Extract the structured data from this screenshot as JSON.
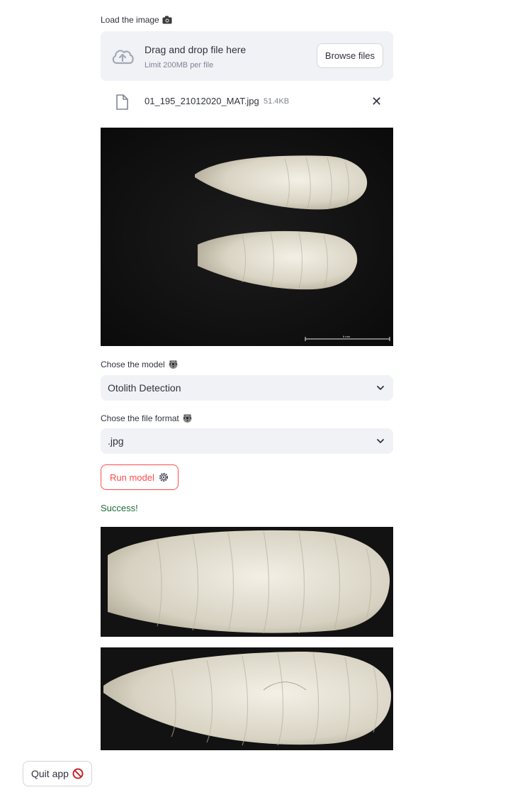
{
  "uploader": {
    "label": "Load the image",
    "label_icon": "camera-icon",
    "drop_title": "Drag and drop file here",
    "drop_limit": "Limit 200MB per file",
    "browse_label": "Browse files",
    "file_name": "01_195_21012020_MAT.jpg",
    "file_size": "51.4KB"
  },
  "preview": {
    "scale_label": "6 mm"
  },
  "model_select": {
    "label": "Chose the model",
    "label_icon": "raccoon-icon",
    "value": "Otolith Detection"
  },
  "format_select": {
    "label": "Chose the file format",
    "label_icon": "raccoon-icon",
    "value": ".jpg"
  },
  "run_button": {
    "label": "Run model",
    "icon": "gear-icon"
  },
  "status": {
    "text": "Success!"
  },
  "quit_button": {
    "label": "Quit app",
    "icon": "prohibited-icon"
  },
  "colors": {
    "accent": "#ff4b4b",
    "success": "#1e6b39",
    "widget_bg": "#f0f2f6",
    "text": "#31333f"
  }
}
